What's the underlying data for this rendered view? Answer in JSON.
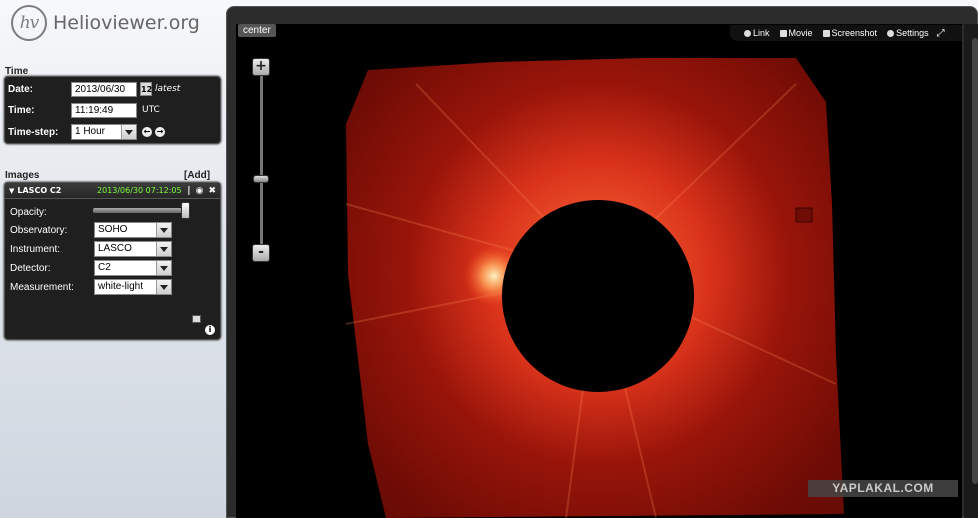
{
  "app": {
    "logo_mark": "hv",
    "logo_text": "Helioviewer.org"
  },
  "time": {
    "section_label": "Time",
    "date_label": "Date:",
    "date_value": "2013/06/30",
    "calendar_text": "12",
    "latest_label": "latest",
    "time_label": "Time:",
    "time_value": "11:19:49",
    "utc_label": "UTC",
    "timestep_label": "Time-step:",
    "timestep_value": "1 Hour"
  },
  "images": {
    "section_label": "Images",
    "add_label": "[Add]",
    "layer": {
      "title": "LASCO C2",
      "date": "2013/06/30 07:12:05",
      "opacity_label": "Opacity:",
      "opacity_value": 1.0,
      "observatory_label": "Observatory:",
      "observatory_value": "SOHO",
      "instrument_label": "Instrument:",
      "instrument_value": "LASCO",
      "detector_label": "Detector:",
      "detector_value": "C2",
      "measurement_label": "Measurement:",
      "measurement_value": "white-light"
    }
  },
  "viewport": {
    "center_label": "center",
    "toolbar": {
      "link": "Link",
      "movie": "Movie",
      "screenshot": "Screenshot",
      "settings": "Settings"
    },
    "zoom_in": "+",
    "zoom_out": "-"
  },
  "watermark": "YAPLAKAL.COM",
  "colors": {
    "panel_bg": "#1f1f1f",
    "corona": "#7a0d05",
    "layer_date": "#7cff3a"
  }
}
